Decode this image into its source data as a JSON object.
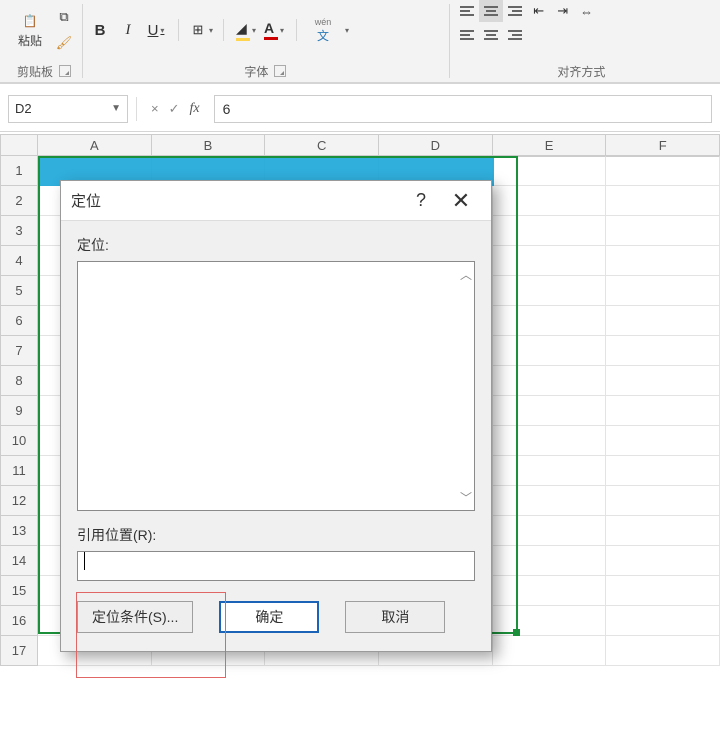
{
  "ribbon": {
    "clipboard": {
      "paste": "粘贴",
      "label": "剪贴板"
    },
    "font": {
      "bold": "B",
      "italic": "I",
      "underline": "U",
      "wen": "wén",
      "wen_sub": "文",
      "label": "字体"
    },
    "align": {
      "label": "对齐方式"
    }
  },
  "formula_bar": {
    "name_box": "D2",
    "cancel": "×",
    "accept": "✓",
    "fx": "fx",
    "formula_value": "6"
  },
  "grid": {
    "columns": [
      "A",
      "B",
      "C",
      "D",
      "E",
      "F"
    ],
    "rows": [
      "1",
      "2",
      "3",
      "4",
      "5",
      "6",
      "7",
      "8",
      "9",
      "10",
      "11",
      "12",
      "13",
      "14",
      "15",
      "16",
      "17"
    ]
  },
  "dialog": {
    "title": "定位",
    "help": "?",
    "close": "✕",
    "goto_label": "定位:",
    "reference_label": "引用位置(R):",
    "reference_value": "",
    "special": "定位条件(S)...",
    "ok": "确定",
    "cancel": "取消"
  }
}
